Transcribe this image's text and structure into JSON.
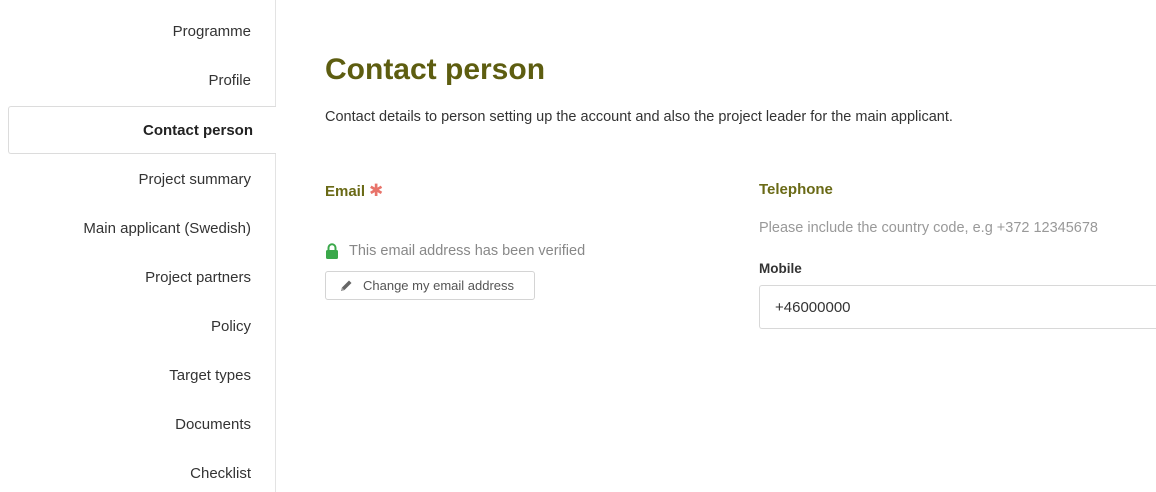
{
  "sidebar": {
    "items": [
      {
        "label": "Programme"
      },
      {
        "label": "Profile"
      },
      {
        "label": "Contact person"
      },
      {
        "label": "Project summary"
      },
      {
        "label": "Main applicant (Swedish)"
      },
      {
        "label": "Project partners"
      },
      {
        "label": "Policy"
      },
      {
        "label": "Target types"
      },
      {
        "label": "Documents"
      },
      {
        "label": "Checklist"
      }
    ],
    "active": "Contact person"
  },
  "main": {
    "title": "Contact person",
    "description": "Contact details to person setting up the account and also the project leader for the main applicant.",
    "email": {
      "label": "Email",
      "required_mark": "✱",
      "verified_text": "This email address has been verified",
      "change_button": "Change my email address"
    },
    "telephone": {
      "label": "Telephone",
      "hint": "Please include the country code, e.g +372 12345678",
      "mobile_label": "Mobile",
      "mobile_value": "+46000000"
    }
  },
  "colors": {
    "title": "#5d5d10",
    "label": "#6a6a16",
    "required": "#e8736a",
    "lock": "#3aa84a"
  },
  "icons": {
    "lock": "lock-icon",
    "pencil": "pencil-icon"
  }
}
